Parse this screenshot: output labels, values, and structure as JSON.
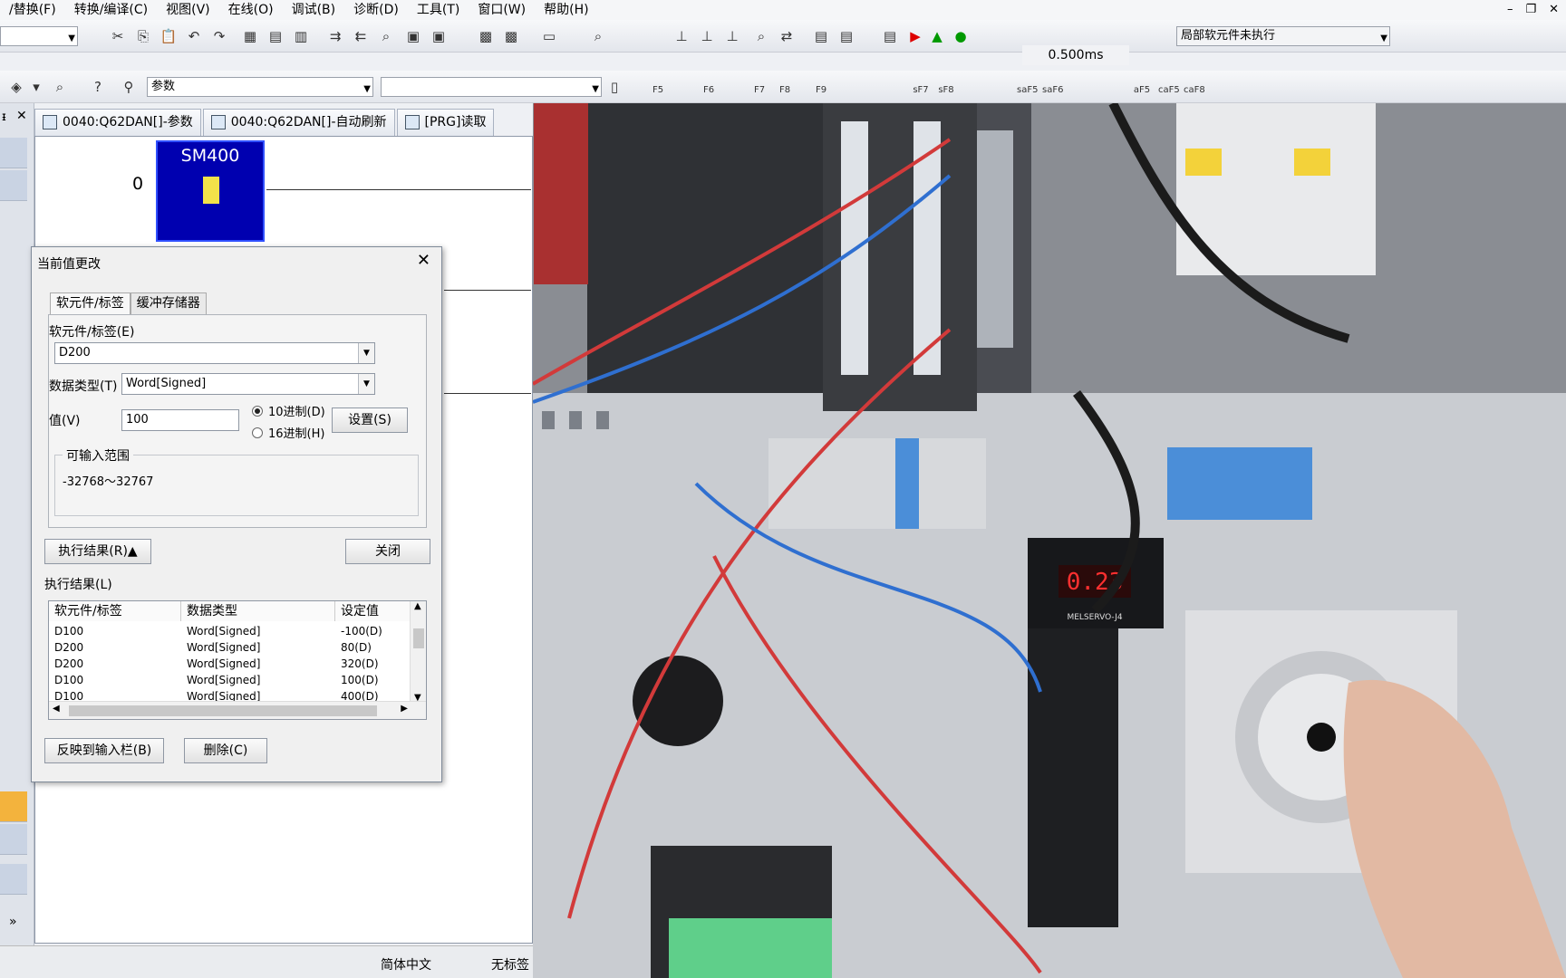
{
  "menu": [
    "/替换(F)",
    "转换/编译(C)",
    "视图(V)",
    "在线(O)",
    "调试(B)",
    "诊断(D)",
    "工具(T)",
    "窗口(W)",
    "帮助(H)"
  ],
  "toolbar": {
    "runtime": "0.500ms",
    "status_combo": "局部软元件未执行",
    "search_combo": "参数",
    "fkey_labels": [
      "F5",
      "F6",
      "F7",
      "F8",
      "F9",
      "sF7",
      "sF8",
      "saF5",
      "saF6",
      "aF5",
      "caF5",
      "caF8"
    ]
  },
  "tabs": [
    "0040:Q62DAN[]-参数",
    "0040:Q62DAN[]-自动刷新",
    "[PRG]读取"
  ],
  "ladder": {
    "row_number": "0",
    "contact_label": "SM400"
  },
  "dialog": {
    "title": "当前值更改",
    "tabs": [
      "软元件/标签",
      "缓冲存储器"
    ],
    "device_label": "软元件/标签(E)",
    "device_value": "D200",
    "dtype_label": "数据类型(T)",
    "dtype_value": "Word[Signed]",
    "value_label": "值(V)",
    "value": "100",
    "radio_dec": "10进制(D)",
    "radio_hex": "16进制(H)",
    "set_button": "设置(S)",
    "range_title": "可输入范围",
    "range_value": "-32768～32767",
    "exec_result_button": "执行结果(R)▲",
    "close_button": "关闭",
    "exec_result_label": "执行结果(L)",
    "table_headers": [
      "软元件/标签",
      "数据类型",
      "设定值"
    ],
    "rows": [
      {
        "dev": "D100",
        "type": "Word[Signed]",
        "val": "-100(D)"
      },
      {
        "dev": "D200",
        "type": "Word[Signed]",
        "val": "80(D)"
      },
      {
        "dev": "D200",
        "type": "Word[Signed]",
        "val": "320(D)"
      },
      {
        "dev": "D100",
        "type": "Word[Signed]",
        "val": "100(D)"
      },
      {
        "dev": "D100",
        "type": "Word[Signed]",
        "val": "400(D)"
      }
    ],
    "reflect_button": "反映到输入栏(B)",
    "delete_button": "删除(C)"
  },
  "statusbar": {
    "lang": "简体中文",
    "tag": "无标签"
  },
  "video": {
    "display_reading": "0.23",
    "brand_text": "MELSERVO-J4"
  }
}
